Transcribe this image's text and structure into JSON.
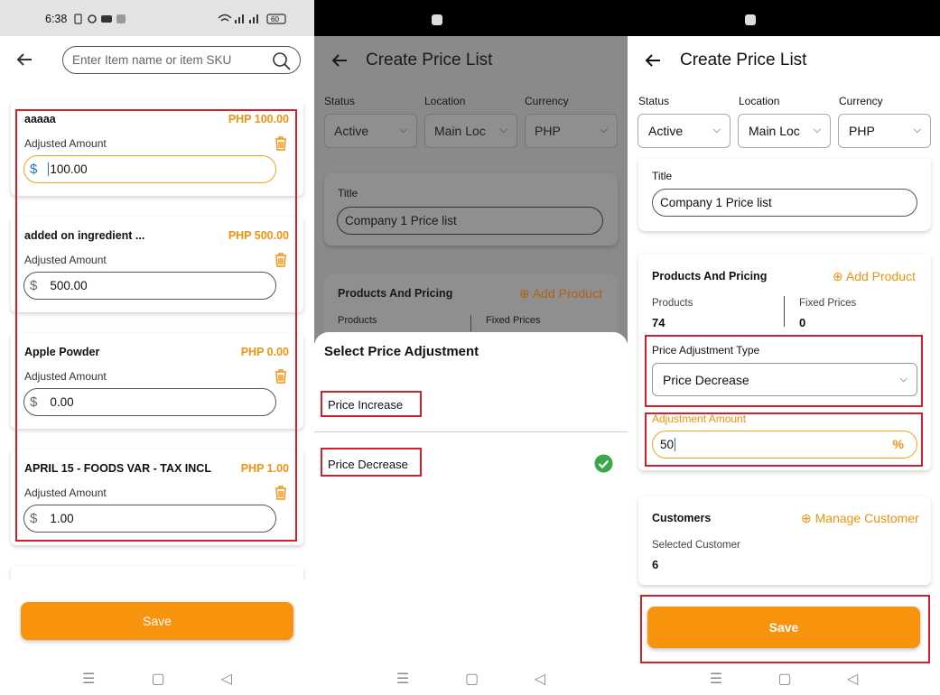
{
  "p1": {
    "status": {
      "time": "6:38",
      "battery": "60"
    },
    "search_placeholder": "Enter Item name or item SKU",
    "adjusted_label": "Adjusted Amount",
    "items": [
      {
        "name": "aaaaa",
        "price": "PHP 100.00",
        "value": "100.00"
      },
      {
        "name": "added on ingredient ...",
        "price": "PHP 500.00",
        "value": "500.00"
      },
      {
        "name": "Apple Powder",
        "price": "PHP 0.00",
        "value": "0.00"
      },
      {
        "name": "APRIL 15 - FOODS VAR - TAX INCL",
        "price": "PHP 1.00",
        "value": "1.00"
      }
    ],
    "currency_symbol": "$",
    "save": "Save"
  },
  "p2": {
    "title": "Create Price List",
    "labels": {
      "status": "Status",
      "location": "Location",
      "currency": "Currency"
    },
    "values": {
      "status": "Active",
      "location": "Main Loc",
      "currency": "PHP"
    },
    "title_label": "Title",
    "title_value": "Company 1 Price list",
    "products_heading": "Products And Pricing",
    "add_product": "Add Product",
    "products_label": "Products",
    "fixed_label": "Fixed Prices",
    "sheet_title": "Select Price Adjustment",
    "options": [
      "Price Increase",
      "Price Decrease"
    ]
  },
  "p3": {
    "title": "Create Price List",
    "labels": {
      "status": "Status",
      "location": "Location",
      "currency": "Currency"
    },
    "values": {
      "status": "Active",
      "location": "Main Loc",
      "currency": "PHP"
    },
    "title_label": "Title",
    "title_value": "Company 1 Price list",
    "products_heading": "Products And Pricing",
    "add_product": "Add Product",
    "products_label": "Products",
    "products_count": "74",
    "fixed_label": "Fixed Prices",
    "fixed_count": "0",
    "adj_type_label": "Price Adjustment Type",
    "adj_type_value": "Price Decrease",
    "adj_amount_label": "Adjustment Amount",
    "adj_amount_value": "50",
    "percent": "%",
    "customers_heading": "Customers",
    "manage_customer": "Manage Customer",
    "selected_label": "Selected Customer",
    "selected_count": "6",
    "save": "Save"
  },
  "colors": {
    "accent": "#f7930d",
    "highlight_box": "#d3202a",
    "check": "#3aa84a"
  }
}
